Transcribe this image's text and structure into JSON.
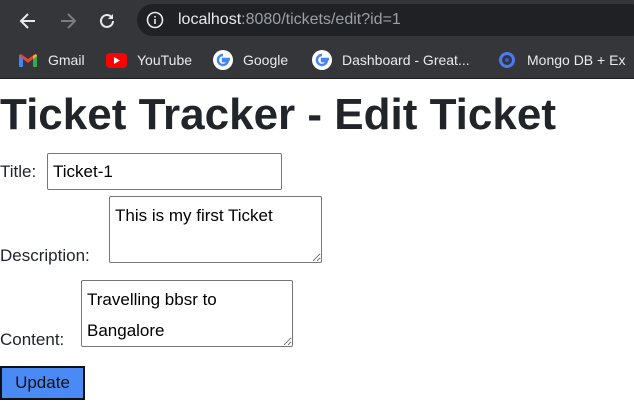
{
  "browser": {
    "url_host": "localhost",
    "url_rest": ":8080/tickets/edit?id=1"
  },
  "bookmarks": [
    {
      "label": "Gmail",
      "icon": "gmail-icon"
    },
    {
      "label": "YouTube",
      "icon": "youtube-icon"
    },
    {
      "label": "Google",
      "icon": "google-icon"
    },
    {
      "label": "Dashboard - Great...",
      "icon": "google-icon"
    },
    {
      "label": "Mongo DB + Ex",
      "icon": "mongodb-icon"
    }
  ],
  "page": {
    "title": "Ticket Tracker - Edit Ticket",
    "title_label": "Title:",
    "title_value": "Ticket-1",
    "description_label": "Description:",
    "description_value": "This is my first Ticket",
    "content_label": "Content:",
    "content_value": "Travelling bbsr to Bangalore",
    "update_label": "Update"
  },
  "colors": {
    "chrome_bg": "#35363a",
    "omnibox_bg": "#202124",
    "button_bg": "#4a8af4",
    "text": "#212529"
  }
}
